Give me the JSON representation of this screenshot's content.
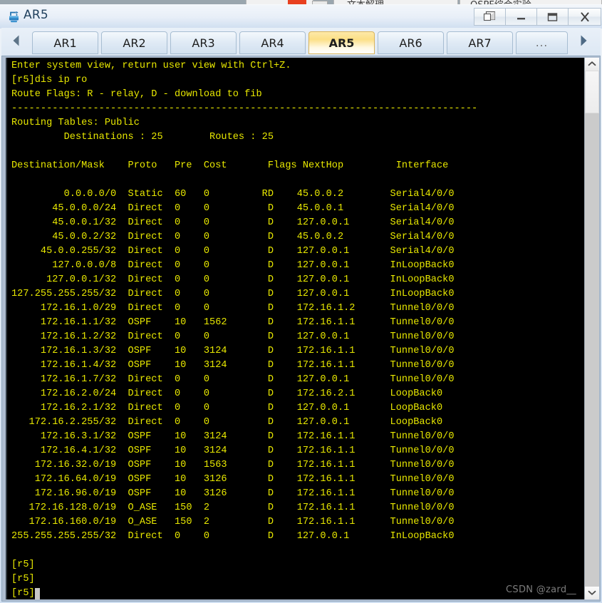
{
  "background_strip": {
    "fragments": [
      "文本解理",
      "OSPF综合实验"
    ],
    "note": "partially visible window behind the main window"
  },
  "window": {
    "title": "AR5",
    "icon": "router-icon",
    "controls": [
      {
        "name": "restore-button",
        "icon": "cascade-windows-icon",
        "label": ""
      },
      {
        "name": "minimize-button",
        "icon": "minimize-icon",
        "label": ""
      },
      {
        "name": "maximize-button",
        "icon": "maximize-icon",
        "label": ""
      },
      {
        "name": "close-button",
        "icon": "close-icon",
        "label": "X"
      }
    ]
  },
  "tabs": {
    "prev_arrow": "left-arrow-icon",
    "next_arrow": "right-arrow-icon",
    "items": [
      {
        "label": "AR1",
        "selected": false
      },
      {
        "label": "AR2",
        "selected": false
      },
      {
        "label": "AR3",
        "selected": false
      },
      {
        "label": "AR4",
        "selected": false
      },
      {
        "label": "AR5",
        "selected": true
      },
      {
        "label": "AR6",
        "selected": false
      },
      {
        "label": "AR7",
        "selected": false
      },
      {
        "label": "...",
        "selected": false
      }
    ]
  },
  "terminal": {
    "foreground_color": "#e8e800",
    "background_color": "#000000",
    "header_lines": [
      "Enter system view, return user view with Ctrl+Z.",
      "[r5]dis ip ro",
      "Route Flags: R - relay, D - download to fib",
      "--------------------------------------------------------------------------------",
      "Routing Tables: Public",
      "         Destinations : 25        Routes : 25"
    ],
    "columns": [
      "Destination/Mask",
      "Proto",
      "Pre",
      "Cost",
      "Flags",
      "NextHop",
      "Interface"
    ],
    "column_header_line": "Destination/Mask    Proto   Pre  Cost       Flags NextHop         Interface",
    "destinations_count": "25",
    "routes_count": "25",
    "rows": [
      {
        "dest": "0.0.0.0/0",
        "proto": "Static",
        "pre": "60",
        "cost": "0",
        "flags": "RD",
        "nexthop": "45.0.0.2",
        "iface": "Serial4/0/0"
      },
      {
        "dest": "45.0.0.0/24",
        "proto": "Direct",
        "pre": "0",
        "cost": "0",
        "flags": "D",
        "nexthop": "45.0.0.1",
        "iface": "Serial4/0/0"
      },
      {
        "dest": "45.0.0.1/32",
        "proto": "Direct",
        "pre": "0",
        "cost": "0",
        "flags": "D",
        "nexthop": "127.0.0.1",
        "iface": "Serial4/0/0"
      },
      {
        "dest": "45.0.0.2/32",
        "proto": "Direct",
        "pre": "0",
        "cost": "0",
        "flags": "D",
        "nexthop": "45.0.0.2",
        "iface": "Serial4/0/0"
      },
      {
        "dest": "45.0.0.255/32",
        "proto": "Direct",
        "pre": "0",
        "cost": "0",
        "flags": "D",
        "nexthop": "127.0.0.1",
        "iface": "Serial4/0/0"
      },
      {
        "dest": "127.0.0.0/8",
        "proto": "Direct",
        "pre": "0",
        "cost": "0",
        "flags": "D",
        "nexthop": "127.0.0.1",
        "iface": "InLoopBack0"
      },
      {
        "dest": "127.0.0.1/32",
        "proto": "Direct",
        "pre": "0",
        "cost": "0",
        "flags": "D",
        "nexthop": "127.0.0.1",
        "iface": "InLoopBack0"
      },
      {
        "dest": "127.255.255.255/32",
        "proto": "Direct",
        "pre": "0",
        "cost": "0",
        "flags": "D",
        "nexthop": "127.0.0.1",
        "iface": "InLoopBack0"
      },
      {
        "dest": "172.16.1.0/29",
        "proto": "Direct",
        "pre": "0",
        "cost": "0",
        "flags": "D",
        "nexthop": "172.16.1.2",
        "iface": "Tunnel0/0/0"
      },
      {
        "dest": "172.16.1.1/32",
        "proto": "OSPF",
        "pre": "10",
        "cost": "1562",
        "flags": "D",
        "nexthop": "172.16.1.1",
        "iface": "Tunnel0/0/0"
      },
      {
        "dest": "172.16.1.2/32",
        "proto": "Direct",
        "pre": "0",
        "cost": "0",
        "flags": "D",
        "nexthop": "127.0.0.1",
        "iface": "Tunnel0/0/0"
      },
      {
        "dest": "172.16.1.3/32",
        "proto": "OSPF",
        "pre": "10",
        "cost": "3124",
        "flags": "D",
        "nexthop": "172.16.1.1",
        "iface": "Tunnel0/0/0"
      },
      {
        "dest": "172.16.1.4/32",
        "proto": "OSPF",
        "pre": "10",
        "cost": "3124",
        "flags": "D",
        "nexthop": "172.16.1.1",
        "iface": "Tunnel0/0/0"
      },
      {
        "dest": "172.16.1.7/32",
        "proto": "Direct",
        "pre": "0",
        "cost": "0",
        "flags": "D",
        "nexthop": "127.0.0.1",
        "iface": "Tunnel0/0/0"
      },
      {
        "dest": "172.16.2.0/24",
        "proto": "Direct",
        "pre": "0",
        "cost": "0",
        "flags": "D",
        "nexthop": "172.16.2.1",
        "iface": "LoopBack0"
      },
      {
        "dest": "172.16.2.1/32",
        "proto": "Direct",
        "pre": "0",
        "cost": "0",
        "flags": "D",
        "nexthop": "127.0.0.1",
        "iface": "LoopBack0"
      },
      {
        "dest": "172.16.2.255/32",
        "proto": "Direct",
        "pre": "0",
        "cost": "0",
        "flags": "D",
        "nexthop": "127.0.0.1",
        "iface": "LoopBack0"
      },
      {
        "dest": "172.16.3.1/32",
        "proto": "OSPF",
        "pre": "10",
        "cost": "3124",
        "flags": "D",
        "nexthop": "172.16.1.1",
        "iface": "Tunnel0/0/0"
      },
      {
        "dest": "172.16.4.1/32",
        "proto": "OSPF",
        "pre": "10",
        "cost": "3124",
        "flags": "D",
        "nexthop": "172.16.1.1",
        "iface": "Tunnel0/0/0"
      },
      {
        "dest": "172.16.32.0/19",
        "proto": "OSPF",
        "pre": "10",
        "cost": "1563",
        "flags": "D",
        "nexthop": "172.16.1.1",
        "iface": "Tunnel0/0/0"
      },
      {
        "dest": "172.16.64.0/19",
        "proto": "OSPF",
        "pre": "10",
        "cost": "3126",
        "flags": "D",
        "nexthop": "172.16.1.1",
        "iface": "Tunnel0/0/0"
      },
      {
        "dest": "172.16.96.0/19",
        "proto": "OSPF",
        "pre": "10",
        "cost": "3126",
        "flags": "D",
        "nexthop": "172.16.1.1",
        "iface": "Tunnel0/0/0"
      },
      {
        "dest": "172.16.128.0/19",
        "proto": "O_ASE",
        "pre": "150",
        "cost": "2",
        "flags": "D",
        "nexthop": "172.16.1.1",
        "iface": "Tunnel0/0/0"
      },
      {
        "dest": "172.16.160.0/19",
        "proto": "O_ASE",
        "pre": "150",
        "cost": "2",
        "flags": "D",
        "nexthop": "172.16.1.1",
        "iface": "Tunnel0/0/0"
      },
      {
        "dest": "255.255.255.255/32",
        "proto": "Direct",
        "pre": "0",
        "cost": "0",
        "flags": "D",
        "nexthop": "127.0.0.1",
        "iface": "InLoopBack0"
      }
    ],
    "trailing_prompts": [
      "[r5]",
      "[r5]",
      "[r5]"
    ],
    "cursor_after_prompt": true
  },
  "watermark": "CSDN @zard__",
  "scrollbar": {
    "up_arrow": "chevron-up-icon",
    "down_arrow": "chevron-down-icon",
    "thumb_position": "near-top"
  }
}
